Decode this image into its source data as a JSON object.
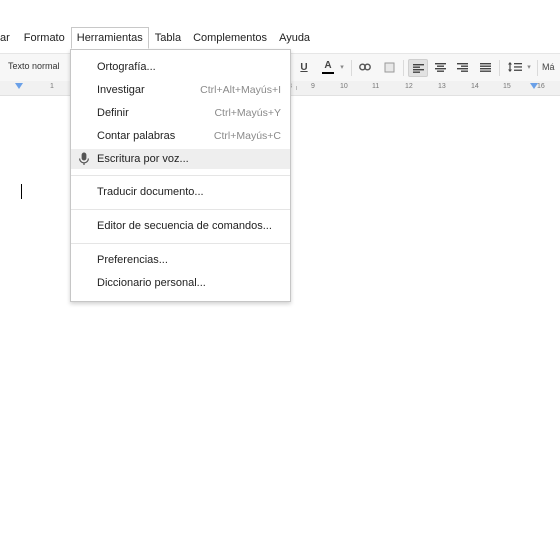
{
  "menubar": {
    "items": [
      "ar",
      "Formato",
      "Herramientas",
      "Tabla",
      "Complementos",
      "Ayuda"
    ],
    "active_index": 2
  },
  "toolbar": {
    "style_label": "Texto normal",
    "underline_label": "U",
    "text_color_label": "A",
    "text_color_accent": "#000000",
    "more_label": "Má"
  },
  "ruler": {
    "numbers": [
      "1",
      "8",
      "9",
      "10",
      "11",
      "12",
      "13",
      "14",
      "15",
      "16"
    ]
  },
  "tools_menu": {
    "items": [
      {
        "label": "Ortografía...",
        "shortcut": ""
      },
      {
        "label": "Investigar",
        "shortcut": "Ctrl+Alt+Mayús+I"
      },
      {
        "label": "Definir",
        "shortcut": "Ctrl+Mayús+Y"
      },
      {
        "label": "Contar palabras",
        "shortcut": "Ctrl+Mayús+C"
      },
      {
        "label": "Escritura por voz...",
        "shortcut": "",
        "icon": "microphone-icon"
      },
      {
        "label": "Traducir documento...",
        "shortcut": ""
      },
      {
        "label": "Editor de secuencia de comandos...",
        "shortcut": ""
      },
      {
        "label": "Preferencias...",
        "shortcut": ""
      },
      {
        "label": "Diccionario personal...",
        "shortcut": ""
      }
    ]
  }
}
